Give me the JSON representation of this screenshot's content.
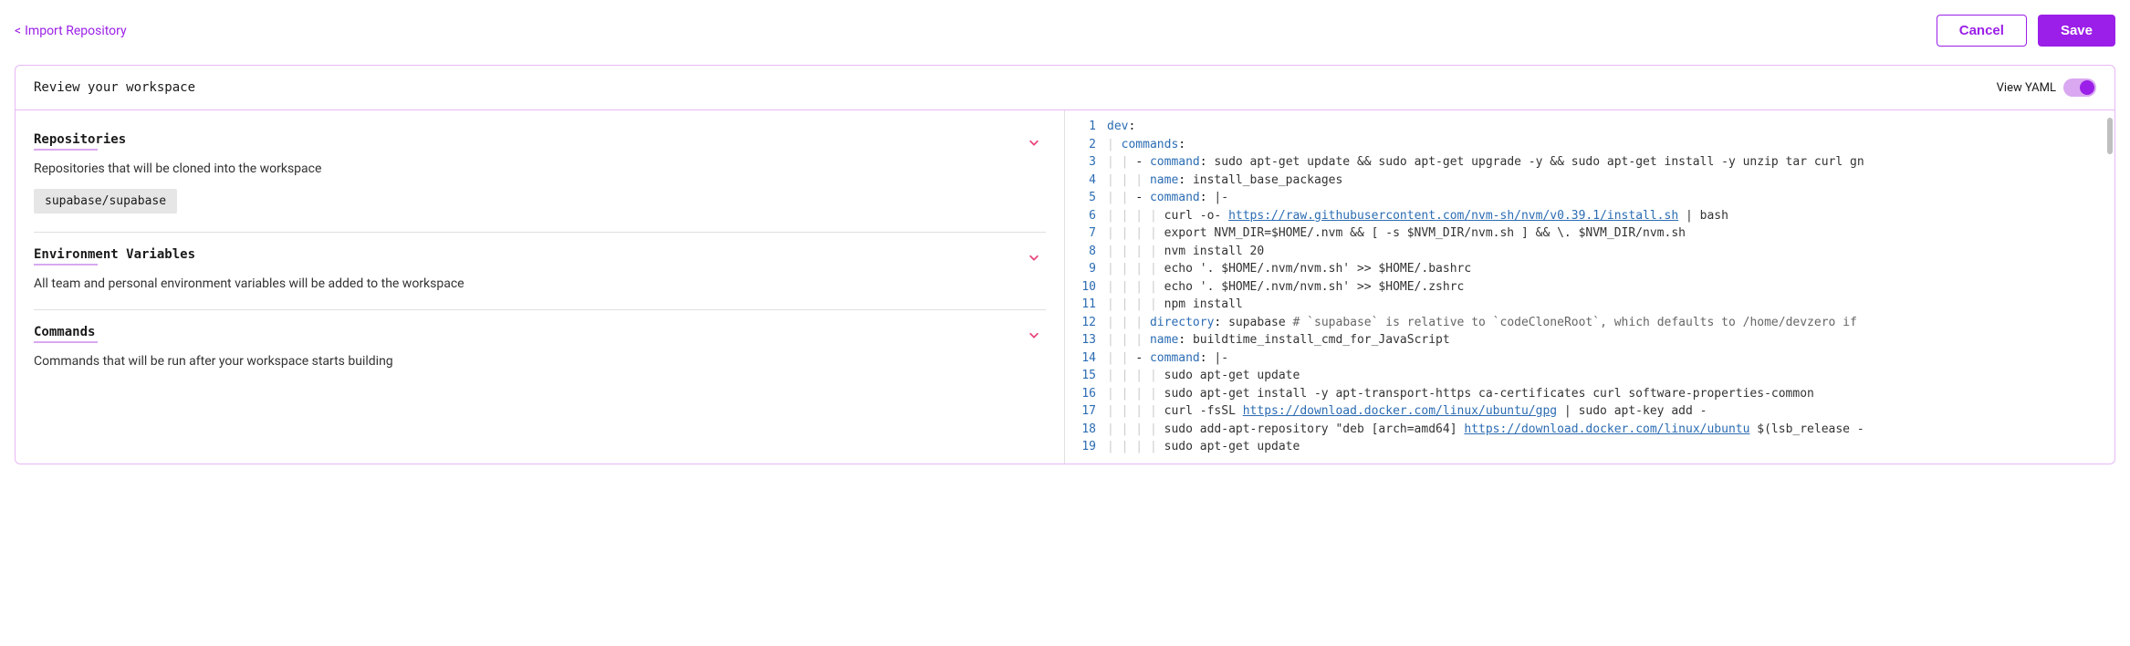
{
  "header": {
    "back_text": "Import Repository",
    "cancel_label": "Cancel",
    "save_label": "Save"
  },
  "panel": {
    "title": "Review your workspace",
    "view_yaml_label": "View YAML"
  },
  "sections": {
    "repositories": {
      "title": "Repositories",
      "description": "Repositories that will be cloned into the workspace",
      "chip": "supabase/supabase"
    },
    "env": {
      "title": "Environment Variables",
      "description": "All team and personal environment variables will be added to the workspace"
    },
    "commands": {
      "title": "Commands",
      "description": "Commands that will be run after your workspace starts building"
    }
  },
  "yaml": {
    "l1_key": "dev",
    "l2_key": "commands",
    "l3_key": "command",
    "l3_val": "sudo apt-get update && sudo apt-get upgrade -y && sudo apt-get install -y unzip tar curl gn",
    "l4_key": "name",
    "l4_val": "install_base_packages",
    "l5_key": "command",
    "l5_val": "|-",
    "l6": "curl -o- ",
    "l6_url": "https://raw.githubusercontent.com/nvm-sh/nvm/v0.39.1/install.sh",
    "l6_rest": " | bash",
    "l7": "export NVM_DIR=$HOME/.nvm && [ -s $NVM_DIR/nvm.sh ] && \\. $NVM_DIR/nvm.sh",
    "l8": "nvm install 20",
    "l9": "echo '. $HOME/.nvm/nvm.sh' >> $HOME/.bashrc",
    "l10": "echo '. $HOME/.nvm/nvm.sh' >> $HOME/.zshrc",
    "l11": "npm install",
    "l12_key": "directory",
    "l12_val": "supabase ",
    "l12_comment": "# `supabase` is relative to `codeCloneRoot`, which defaults to /home/devzero if",
    "l13_key": "name",
    "l13_val": "buildtime_install_cmd_for_JavaScript",
    "l14_key": "command",
    "l14_val": "|-",
    "l15": "sudo apt-get update",
    "l16": "sudo apt-get install -y apt-transport-https ca-certificates curl software-properties-common",
    "l17": "curl -fsSL ",
    "l17_url": "https://download.docker.com/linux/ubuntu/gpg",
    "l17_rest": " | sudo apt-key add -",
    "l18_pre": "sudo add-apt-repository \"deb [arch=amd64] ",
    "l18_url": "https://download.docker.com/linux/ubuntu",
    "l18_rest": " $(lsb_release -",
    "l19": "sudo apt-get update"
  },
  "line_numbers": [
    "1",
    "2",
    "3",
    "4",
    "5",
    "6",
    "7",
    "8",
    "9",
    "10",
    "11",
    "12",
    "13",
    "14",
    "15",
    "16",
    "17",
    "18",
    "19"
  ]
}
